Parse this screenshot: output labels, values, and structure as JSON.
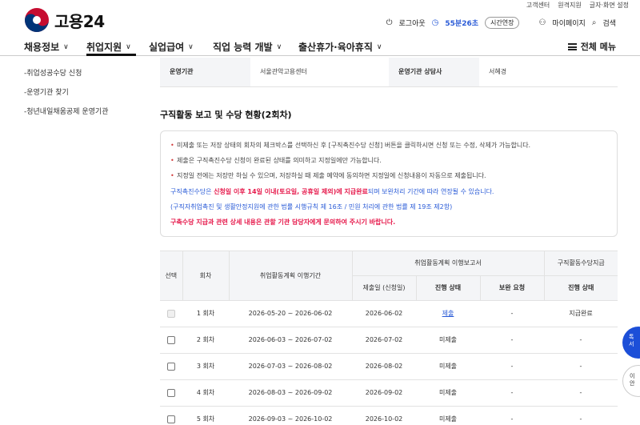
{
  "util": {
    "items": [
      "고객센터",
      "원격지원",
      "글자·화면 설정"
    ]
  },
  "brand": {
    "name": "고용24"
  },
  "userbar": {
    "logout": "로그아웃",
    "timer": "55분26초",
    "extend": "시간연장",
    "mypage": "마이페이지",
    "search": "검색"
  },
  "gnb": {
    "items": [
      "채용정보",
      "취업지원",
      "실업급여",
      "직업 능력 개발",
      "출산휴가·육아휴직"
    ],
    "active_index": 1,
    "allmenu": "전체 메뉴"
  },
  "sidebar": {
    "items": [
      "-취업성공수당 신청",
      "-운영기관 찾기",
      "-청년내일채움공제 운영기관"
    ]
  },
  "info": {
    "org_label": "운영기관",
    "org_value": "서울관악고용센터",
    "counselor_label": "운영기관 상담사",
    "counselor_value": "서혜경"
  },
  "section": {
    "title": "구직활동 보고 및 수당 현황(2회차)"
  },
  "notice": {
    "bullets": [
      "미제출 또는 저장 상태의 회차의 체크박스를 선택하신 후 [구직촉진수당 신청] 버튼을 클릭하시면 신청 또는 수정, 삭제가 가능합니다.",
      "제출은 구직촉진수당 신청이 완료된 상태를 의미하고 지정일에만 가능합니다.",
      "지정일 전에는 저장만 하실 수 있으며, 저장하실 때 제출 예약에 동의하면 지정일에 신청내용이 자동으로 제출됩니다."
    ],
    "blue1_pre": "구직촉진수당은 ",
    "blue1_red": "신청일 이후 14일 이내(토요일, 공휴일 제외)에 지급완료",
    "blue1_post": "되며 보완처리 기간에 따라 연장될 수 있습니다.",
    "blue2": "(구직자취업촉진 및 생활안정지원에 관한 법률 시행규칙 제 16조 / 민원 처리에 관한 법률 제 19조 제2항)",
    "red_line": "구촉수당 지급과 관련 상세 내용은 관할 기관 담당자에게 문의하여 주시기 바랍니다."
  },
  "table": {
    "headers": {
      "select": "선택",
      "round": "회차",
      "period": "취업활동계획 이행기간",
      "report_group": "취업활동계획 이행보고서",
      "submit_date": "제출일 (신청일)",
      "progress": "진행 상태",
      "supplement": "보완 요청",
      "allowance_group": "구직활동수당지급",
      "allowance_status": "진행 상태"
    },
    "rows": [
      {
        "round": "1 회차",
        "period": "2026-05-20 ~ 2026-06-02",
        "date": "2026-06-02",
        "status": "제출",
        "supplement": "-",
        "pay": "지급완료"
      },
      {
        "round": "2 회차",
        "period": "2026-06-03 ~ 2026-07-02",
        "date": "2026-07-02",
        "status": "미제출",
        "supplement": "-",
        "pay": "-"
      },
      {
        "round": "3 회차",
        "period": "2026-07-03 ~ 2026-08-02",
        "date": "2026-08-02",
        "status": "미제출",
        "supplement": "-",
        "pay": "-"
      },
      {
        "round": "4 회차",
        "period": "2026-08-03 ~ 2026-09-02",
        "date": "2026-09-02",
        "status": "미제출",
        "supplement": "-",
        "pay": "-"
      },
      {
        "round": "5 회차",
        "period": "2026-09-03 ~ 2026-10-02",
        "date": "2026-10-02",
        "status": "미제출",
        "supplement": "-",
        "pay": "-"
      }
    ]
  },
  "floating": {
    "btn1": "톡\n서",
    "btn2": "이\n안"
  }
}
